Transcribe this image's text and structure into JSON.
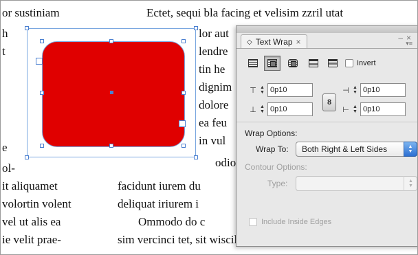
{
  "document": {
    "left_lines": [
      "or sustiniam",
      "h",
      "t",
      "",
      "",
      "",
      "e",
      "ol-",
      "it aliquamet",
      "volortin volent",
      "vel ut alis ea",
      "ie velit prae-"
    ],
    "right_top_line": "Ectet, sequi bla facing et velisim zzril utat",
    "right_lines": [
      "lor aut",
      "lendre",
      "tin he",
      "dignim",
      "dolore",
      "ea feu",
      "in vul",
      "odio c"
    ],
    "bottom_lines": [
      "facidunt iurem du",
      "deliquat iriurem i",
      "Ommodo do c",
      "sim vercinci tet, sit wiscilit autet aciduis nibh"
    ]
  },
  "colors": {
    "shape_fill": "#e00000",
    "selection": "#4a7fd0",
    "accent_select": "#2d6fd2"
  },
  "panel": {
    "tab_label": "Text Wrap",
    "close_glyph": "×",
    "collapse_glyph": "◇",
    "minimize_glyph": "–",
    "close_panel_glyph": "×",
    "menu_glyph": "▾≡",
    "invert_label": "Invert",
    "top_offset": "0p10",
    "bottom_offset": "0p10",
    "left_offset": "0p10",
    "right_offset": "0p10",
    "wrap_options_title": "Wrap Options:",
    "wrap_to_label": "Wrap To:",
    "wrap_to_value": "Both Right & Left Sides",
    "contour_options_title": "Contour Options:",
    "type_label": "Type:",
    "type_value": "",
    "include_inside_edges_label": "Include Inside Edges",
    "wrap_modes": [
      "no-text-wrap-icon",
      "wrap-around-bounding-box-icon",
      "wrap-around-object-shape-icon",
      "jump-object-icon",
      "jump-to-next-column-icon"
    ],
    "selected_wrap_mode": "wrap-around-bounding-box-icon"
  }
}
